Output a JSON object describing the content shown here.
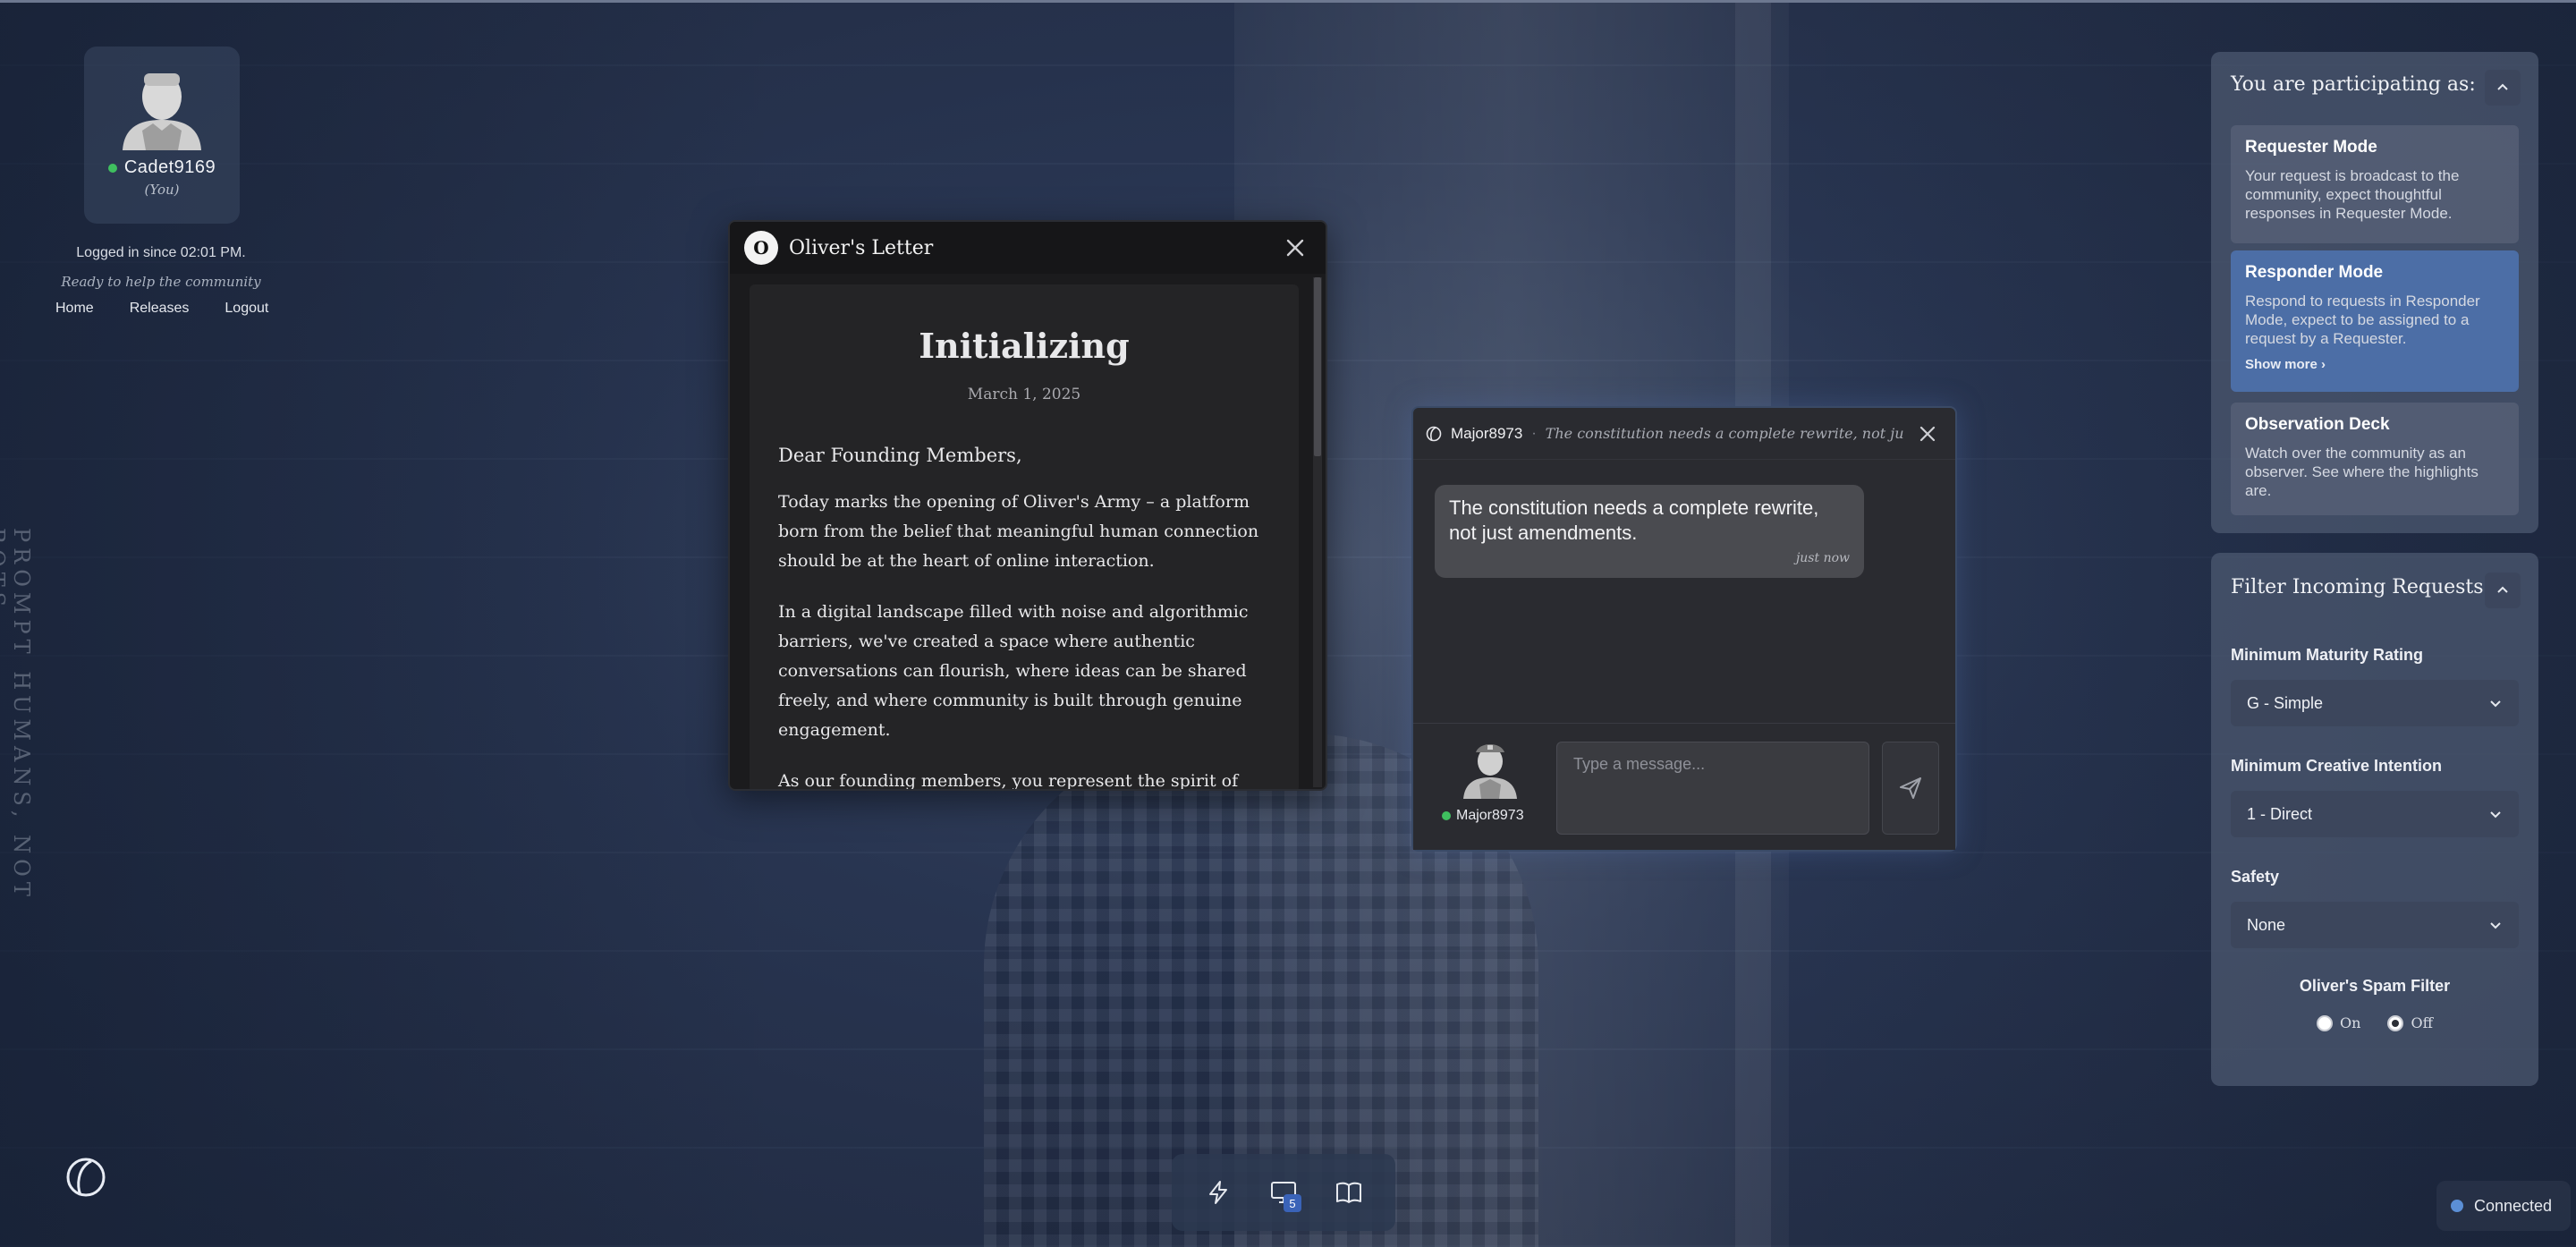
{
  "user": {
    "name": "Cadet9169",
    "you_label": "(You)",
    "logged_in": "Logged in since 02:01 PM.",
    "tagline": "Ready to help the community"
  },
  "nav": {
    "home": "Home",
    "releases": "Releases",
    "logout": "Logout"
  },
  "vertical_tagline": "PROMPT HUMANS, NOT BOTS.",
  "letter": {
    "logo_letter": "O",
    "window_title": "Oliver's Letter",
    "heading": "Initializing",
    "date": "March 1, 2025",
    "greeting": "Dear Founding Members,",
    "paragraphs": [
      "Today marks the opening of Oliver's Army – a platform born from the belief that meaningful human connection should be at the heart of online interaction.",
      "In a digital landscape filled with noise and algorithmic barriers, we've created a space where authentic conversations can flourish, where ideas can be shared freely, and where community is built through genuine engagement.",
      "As our founding members, you represent the spirit of this"
    ]
  },
  "chat": {
    "user": "Major8973",
    "separator": "·",
    "preview": "The constitution needs a complete rewrite, not just amen",
    "message": "The constitution needs a complete rewrite, not just amendments.",
    "message_time": "just now",
    "footer_user": "Major8973",
    "input_placeholder": "Type a message..."
  },
  "participation": {
    "title": "You are participating as:",
    "modes": [
      {
        "title": "Requester Mode",
        "desc": "Your request is broadcast to the community, expect thoughtful responses in Requester Mode."
      },
      {
        "title": "Responder Mode",
        "desc": "Respond to requests in Responder Mode, expect to be assigned to a request by a Requester.",
        "show_more": "Show more ›"
      },
      {
        "title": "Observation Deck",
        "desc": "Watch over the community as an observer. See where the highlights are."
      }
    ]
  },
  "filters": {
    "title": "Filter Incoming Requests",
    "maturity_label": "Minimum Maturity Rating",
    "maturity_value": "G - Simple",
    "creative_label": "Minimum Creative Intention",
    "creative_value": "1 - Direct",
    "safety_label": "Safety",
    "safety_value": "None",
    "spam_label": "Oliver's Spam Filter",
    "spam_on": "On",
    "spam_off": "Off",
    "spam_selected": "Off"
  },
  "toolbar": {
    "screens_badge": "5"
  },
  "status": {
    "label": "Connected"
  },
  "colors": {
    "accent": "#4c6ea6",
    "online": "#3fbf5f",
    "background": "#25324a"
  }
}
